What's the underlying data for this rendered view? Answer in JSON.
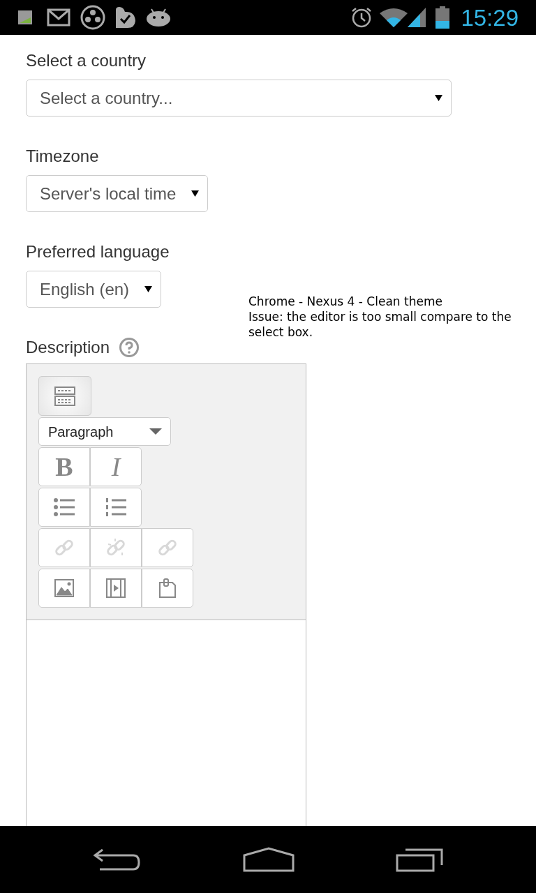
{
  "status_bar": {
    "time": "15:29"
  },
  "fields": [
    {
      "label": "Select a country",
      "value": "Select a country..."
    },
    {
      "label": "Timezone",
      "value": "Server's local time"
    },
    {
      "label": "Preferred language",
      "value": "English (en)"
    }
  ],
  "description": {
    "label": "Description",
    "format": "Paragraph",
    "rows": [
      [
        {
          "kind": "bold",
          "text": "B",
          "disabled": false
        },
        {
          "kind": "italic",
          "text": "I",
          "disabled": false
        }
      ],
      [
        {
          "kind": "bullets",
          "disabled": false
        },
        {
          "kind": "numbers",
          "disabled": false
        }
      ],
      [
        {
          "kind": "link",
          "disabled": true
        },
        {
          "kind": "unlink",
          "disabled": true
        },
        {
          "kind": "anchor",
          "disabled": true
        }
      ],
      [
        {
          "kind": "image",
          "disabled": false
        },
        {
          "kind": "video",
          "disabled": false
        },
        {
          "kind": "paste",
          "disabled": false
        }
      ]
    ]
  },
  "note": [
    "Chrome - Nexus 4 - Clean theme",
    "Issue: the editor is too small compare to the select box."
  ]
}
